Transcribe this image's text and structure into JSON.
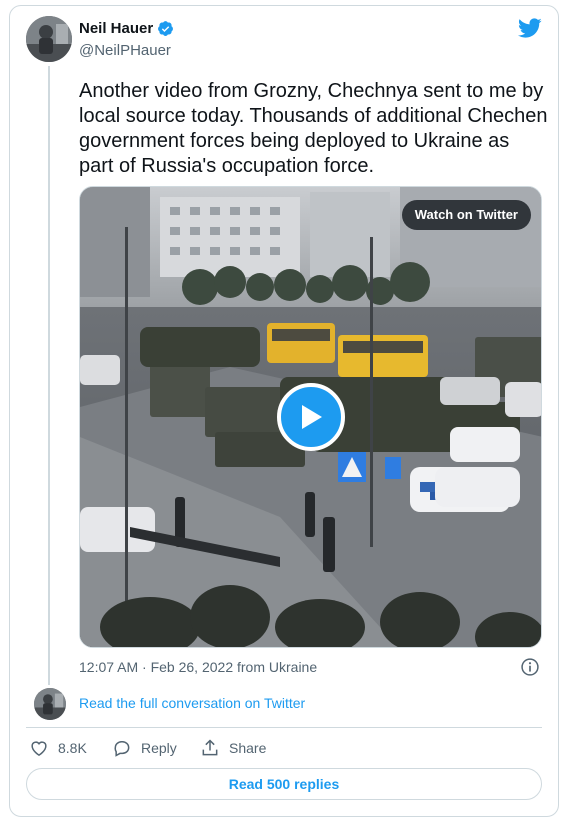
{
  "author": {
    "name": "Neil Hauer",
    "handle": "@NeilPHauer",
    "avatar_icon": "user-avatar",
    "verified_icon": "verified-badge-icon"
  },
  "tweet": {
    "text": "Another video from Grozny, Chechnya sent to me by local source today. Thousands of additional Chechen government forces being deployed to Ukraine as part of Russia's occupation force.",
    "timestamp": "12:07 AM · Feb 26, 2022 from Ukraine"
  },
  "media": {
    "watch_label": "Watch on Twitter",
    "play_icon": "play-icon"
  },
  "conversation": {
    "read_label": "Read the full conversation on Twitter"
  },
  "actions": {
    "like_count": "8.8K",
    "reply_label": "Reply",
    "share_label": "Share"
  },
  "footer": {
    "read_replies_label": "Read 500 replies"
  },
  "colors": {
    "accent": "#1d9bf0",
    "text_primary": "#0f1419",
    "text_secondary": "#536471",
    "border": "#cfd9de"
  }
}
